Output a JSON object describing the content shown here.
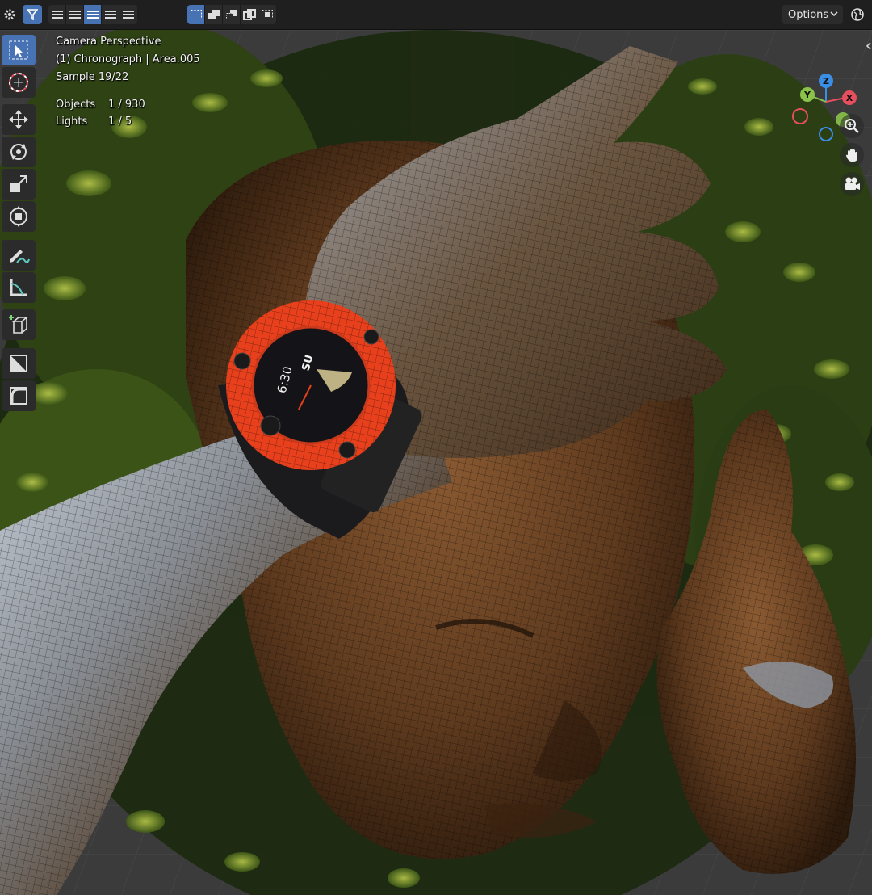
{
  "header": {
    "options_label": "Options"
  },
  "overlay": {
    "view_name": "Camera Perspective",
    "collection_line": "(1) Chronograph | Area.005",
    "sample": "Sample 19/22",
    "objects_label": "Objects",
    "objects_value": "1 / 930",
    "lights_label": "Lights",
    "lights_value": "1 / 5"
  },
  "gizmo": {
    "x": "X",
    "y": "Y",
    "z": "Z"
  },
  "watch": {
    "time": "6:30",
    "day": "SU"
  },
  "colors": {
    "accent": "#4772b3",
    "header_bg": "#1f1f1f",
    "watch_orange": "#e8401c",
    "axis_x": "#e74f5f",
    "axis_y": "#8bc34a",
    "axis_z": "#3a8ee6"
  },
  "icons": {
    "toolbar": [
      "select-box-icon",
      "cursor-icon",
      "move-icon",
      "rotate-icon",
      "scale-icon",
      "transform-icon",
      "annotate-icon",
      "measure-icon",
      "add-cube-icon",
      "shade-icon",
      "bevel-icon"
    ],
    "nav": [
      "zoom-icon",
      "pan-hand-icon",
      "camera-icon"
    ]
  }
}
